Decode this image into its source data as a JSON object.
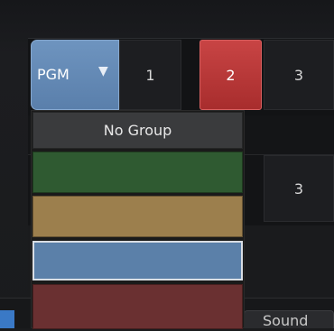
{
  "switcher": {
    "bus_selector": {
      "label": "PGM",
      "caret": "▼"
    },
    "top_row_cells": [
      "1",
      "2",
      "3"
    ],
    "active_cell": "2",
    "second_row_cells": [
      "3"
    ]
  },
  "dropdown": {
    "options": [
      {
        "label": "No Group"
      },
      {
        "label": "",
        "color": "#2f5a31"
      },
      {
        "label": "",
        "color": "#9c7f4d"
      },
      {
        "label": "",
        "color": "#5b80a9",
        "selected": true
      },
      {
        "label": "",
        "color": "#6a3031"
      }
    ]
  },
  "bottom_bar": {
    "sound_tab": "Sound"
  },
  "colors": {
    "pgm_accent": "#5a7fab",
    "active_red": "#a82d2d",
    "tab_blue": "#3a79c6"
  }
}
